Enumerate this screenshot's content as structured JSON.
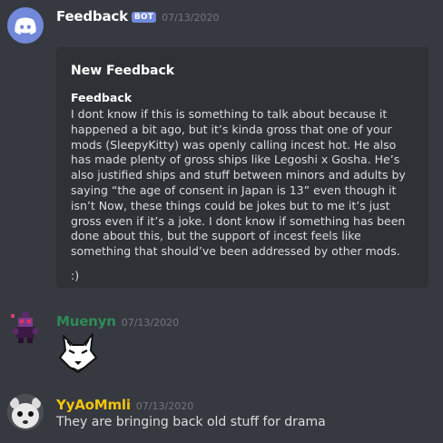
{
  "messages": [
    {
      "username": "Feedback",
      "badge": "BOT",
      "timestamp": "07/13/2020",
      "username_color": "#ffffff",
      "embed": {
        "title": "New Feedback",
        "field_name": "Feedback",
        "field_value": "I dont know if this is something to talk about because it happened a bit ago, but it’s kinda gross that one of your mods (SleepyKitty) was openly calling incest hot. He also has made plenty of gross ships like Legoshi x Gosha. He’s also justified ships and stuff between minors and adults by saying “the age of consent in Japan is 13” even though it isn’t Now, these things could be jokes but to me it’s just gross even if it’s a joke. I dont know if something has been done about this, but the support of incest feels like something that should’ve been addressed by other mods.",
        "field_extra": ":)"
      }
    },
    {
      "username": "Muenyn",
      "timestamp": "07/13/2020",
      "username_color": "#2e8b57"
    },
    {
      "username": "YyAoMmli",
      "timestamp": "07/13/2020",
      "username_color": "#f1c40f",
      "content": "They are bringing back old stuff for drama"
    }
  ]
}
